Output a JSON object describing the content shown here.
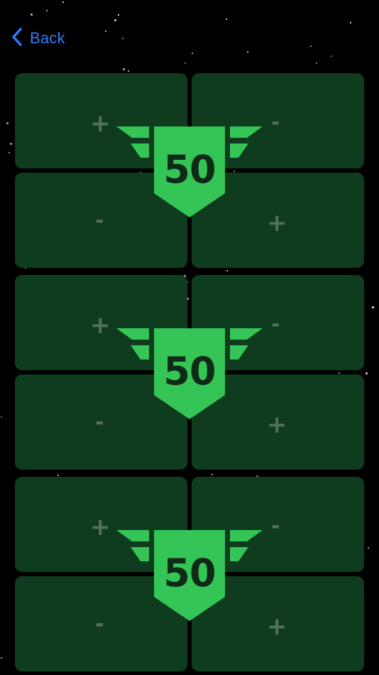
{
  "nav": {
    "back_label": "Back"
  },
  "colors": {
    "panel": "#0f3b1e",
    "badge": "#34c556",
    "accent": "#2f7cf6",
    "symbol": "#556f5c"
  },
  "counters": [
    {
      "score": "50",
      "tl_symbol": "+",
      "tr_symbol": "-",
      "bl_symbol": "-",
      "br_symbol": "+"
    },
    {
      "score": "50",
      "tl_symbol": "+",
      "tr_symbol": "-",
      "bl_symbol": "-",
      "br_symbol": "+"
    },
    {
      "score": "50",
      "tl_symbol": "+",
      "tr_symbol": "-",
      "bl_symbol": "-",
      "br_symbol": "+"
    }
  ]
}
